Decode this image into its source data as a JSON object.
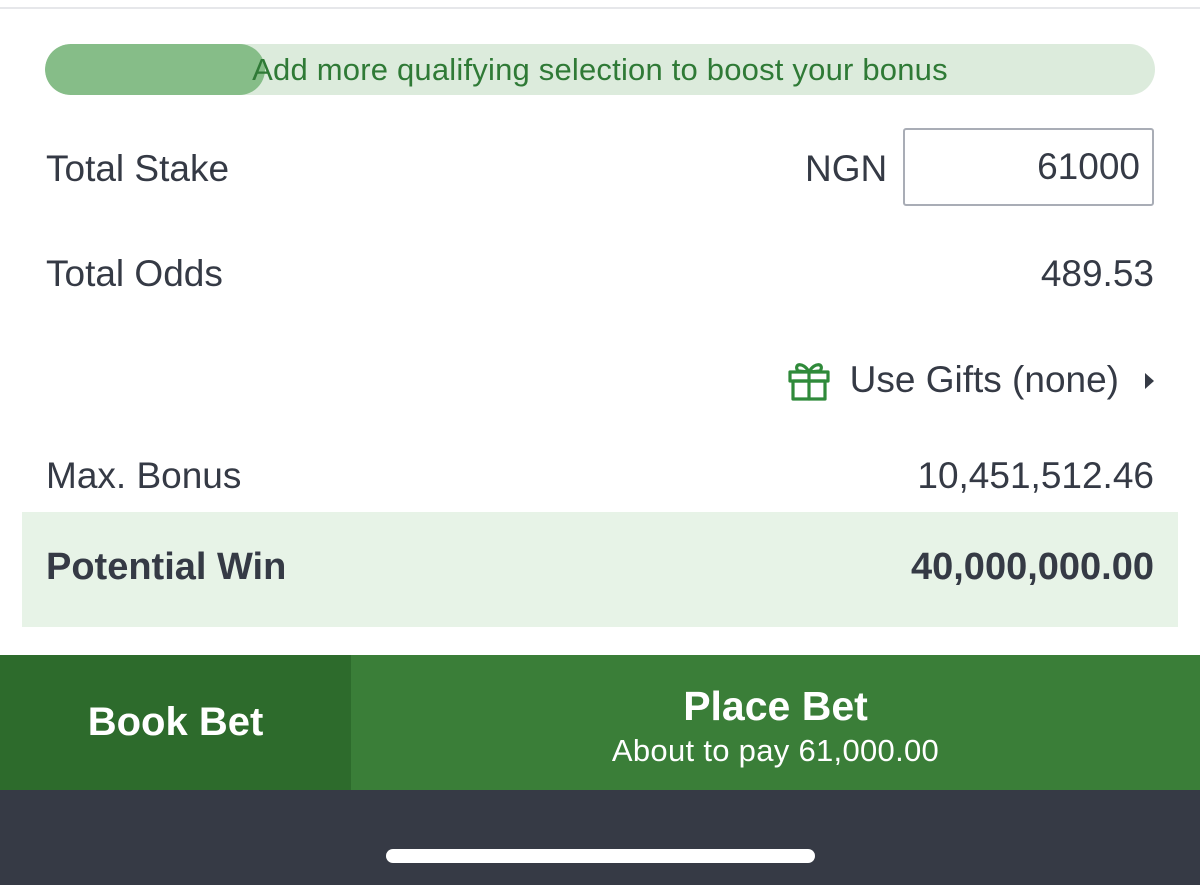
{
  "bonus_progress": {
    "message": "Add more qualifying selection to boost your bonus",
    "fill_fraction": 0.198,
    "fill_color": "#86bd88",
    "track_color": "#dcebdc",
    "text_color": "#2f7a36"
  },
  "total_stake": {
    "label": "Total Stake",
    "currency": "NGN",
    "value": "61000"
  },
  "total_odds": {
    "label": "Total Odds",
    "value": "489.53"
  },
  "gifts": {
    "label": "Use Gifts (none)",
    "icon": "gift-icon",
    "icon_color": "#2f8a3a",
    "arrow_icon": "caret-right-icon"
  },
  "max_bonus": {
    "label": "Max. Bonus",
    "value": "10,451,512.46"
  },
  "potential_win": {
    "label": "Potential Win",
    "value": "40,000,000.00",
    "background": "#e7f3e7"
  },
  "actions": {
    "book_bet": "Book Bet",
    "place_bet": "Place Bet",
    "place_bet_sub": "About to pay 61,000.00",
    "book_color": "#2d6b2c",
    "place_color": "#3a7e38"
  },
  "colors": {
    "text": "#353a45",
    "bottom_bar": "#363a45"
  }
}
